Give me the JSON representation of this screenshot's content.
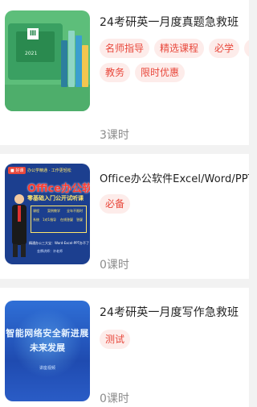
{
  "courses": [
    {
      "title": "24考研英一月度真题急救班",
      "tags": [
        "名师指导",
        "精选课程",
        "必学",
        "多",
        "教务",
        "限时优惠"
      ],
      "lessons": "3课时",
      "thumb": {
        "doc_icon": "Ⅲ",
        "year": "2021"
      }
    },
    {
      "title": "Office办公软件Excel/Word/PPT",
      "tags": [
        "必备"
      ],
      "lessons": "0课时",
      "thumb": {
        "logo": "■ 好课",
        "headline": "办公学精通 · 工作更轻松",
        "big": "Office办公软件",
        "sub": "零基础入门公开试听课",
        "cells": [
          "课程",
          "系统",
          "案例教学",
          "全年不限时",
          "1对1指导",
          "在线答疑",
          "答疑"
        ],
        "foot1": "精通办公三大宝：Word-Excel-PPT办不了",
        "foot2": "金牌讲师：许老师"
      }
    },
    {
      "title": "24考研英一月度写作急救班",
      "tags": [
        "测试"
      ],
      "lessons": "0课时",
      "thumb": {
        "line1": "智能网络安全新进展",
        "line2": "未来发展",
        "line3": "讲座视频"
      }
    }
  ]
}
